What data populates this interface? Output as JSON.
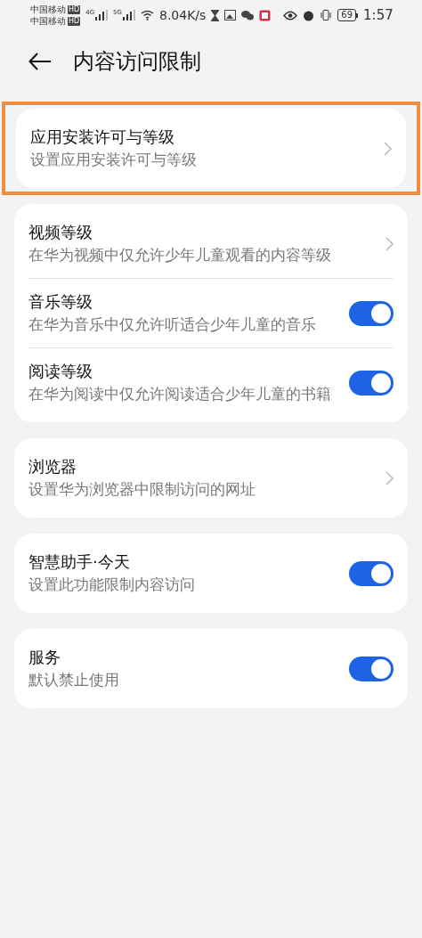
{
  "status_bar": {
    "carriers": [
      "中国移动",
      "中国移动"
    ],
    "hd_badges": [
      "HD",
      "HD"
    ],
    "network_labels": [
      "4G",
      "5G"
    ],
    "speed": "8.04K/s",
    "battery": "69",
    "time": "1:57"
  },
  "header": {
    "title": "内容访问限制"
  },
  "groups": [
    {
      "highlighted": true,
      "items": [
        {
          "kind": "chevron",
          "title": "应用安装许可与等级",
          "subtitle": "设置应用安装许可与等级"
        }
      ]
    },
    {
      "highlighted": false,
      "items": [
        {
          "kind": "chevron",
          "title": "视频等级",
          "subtitle": "在华为视频中仅允许少年儿童观看的内容等级"
        },
        {
          "kind": "switch",
          "title": "音乐等级",
          "subtitle": "在华为音乐中仅允许听适合少年儿童的音乐",
          "on": true
        },
        {
          "kind": "switch",
          "title": "阅读等级",
          "subtitle": "在华为阅读中仅允许阅读适合少年儿童的书籍",
          "on": true
        }
      ]
    },
    {
      "highlighted": false,
      "items": [
        {
          "kind": "chevron",
          "title": "浏览器",
          "subtitle": "设置华为浏览器中限制访问的网址"
        }
      ]
    },
    {
      "highlighted": false,
      "items": [
        {
          "kind": "switch",
          "title": "智慧助手·今天",
          "subtitle": "设置此功能限制内容访问",
          "on": true
        }
      ]
    },
    {
      "highlighted": false,
      "items": [
        {
          "kind": "switch",
          "title": "服务",
          "subtitle": "默认禁止使用",
          "on": true
        }
      ]
    }
  ]
}
